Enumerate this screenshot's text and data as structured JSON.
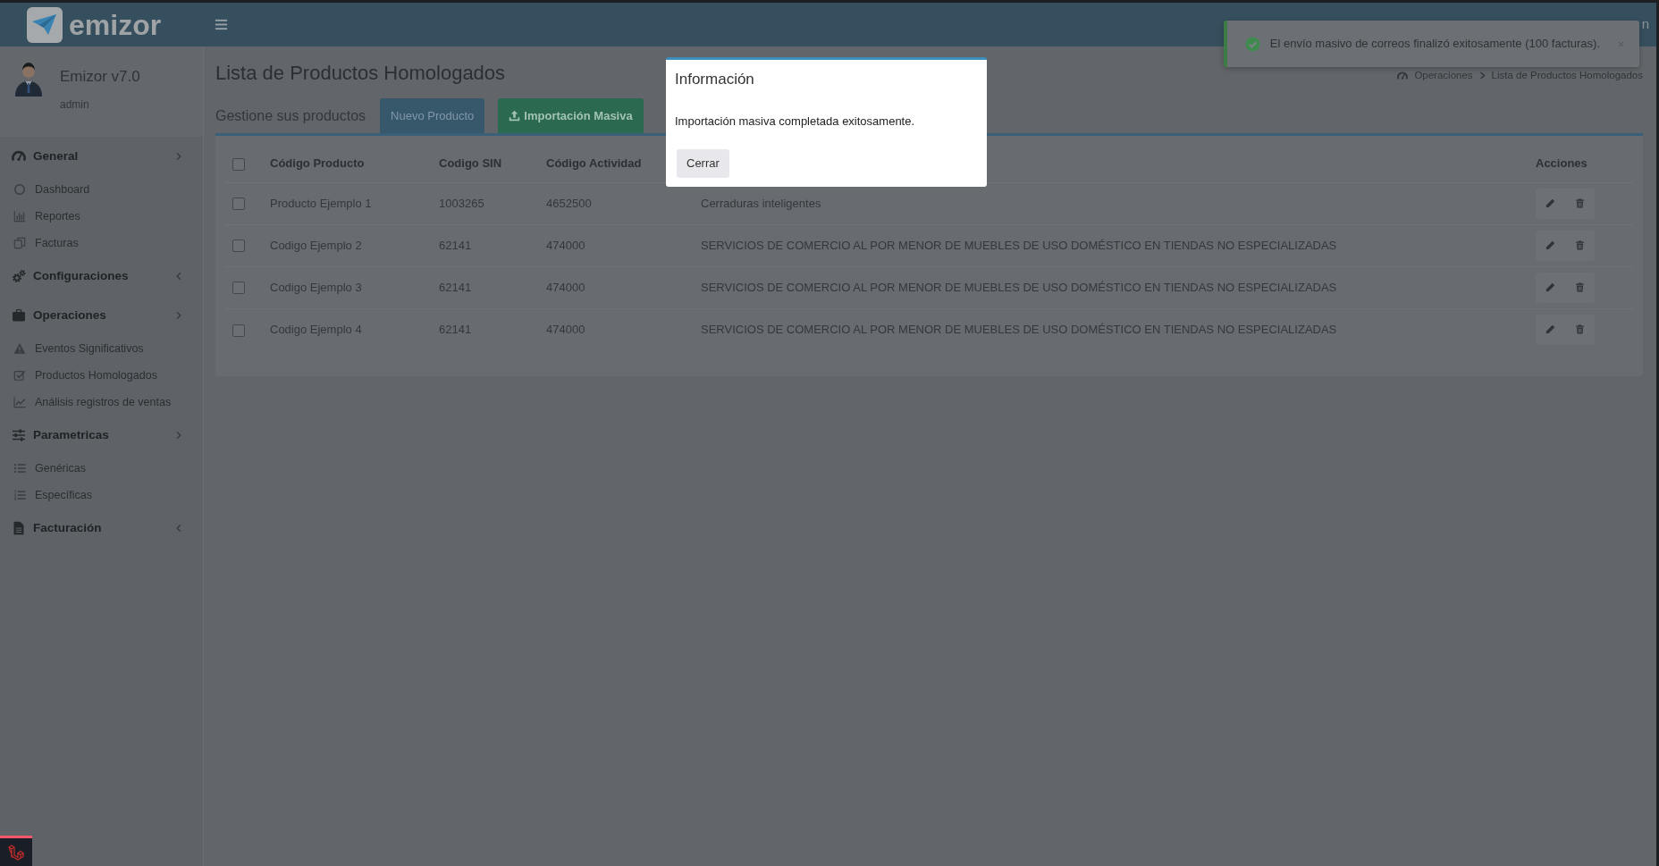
{
  "header": {
    "logo_text": "emizor",
    "user_text": "n"
  },
  "sidebar": {
    "user": {
      "name": "Emizor v7.0",
      "role": "admin"
    },
    "groups": [
      {
        "label": "General",
        "expanded": true,
        "children": [
          {
            "label": "Dashboard"
          },
          {
            "label": "Reportes"
          },
          {
            "label": "Facturas"
          }
        ]
      },
      {
        "label": "Configuraciones",
        "expanded": false
      },
      {
        "label": "Operaciones",
        "expanded": true,
        "children": [
          {
            "label": "Eventos Significativos"
          },
          {
            "label": "Productos Homologados"
          },
          {
            "label": "Análisis registros de ventas"
          }
        ]
      },
      {
        "label": "Parametricas",
        "expanded": true,
        "children": [
          {
            "label": "Genéricas"
          },
          {
            "label": "Específicas"
          }
        ]
      },
      {
        "label": "Facturación",
        "expanded": false
      }
    ]
  },
  "page": {
    "title": "Lista de Productos Homologados",
    "breadcrumb": [
      "Operaciones",
      "Lista de Productos Homologados"
    ]
  },
  "toolbar": {
    "heading": "Gestione sus productos",
    "buttons": [
      {
        "label": "Nuevo Producto",
        "kind": "primary"
      },
      {
        "label": "Importación Masiva",
        "kind": "success"
      }
    ]
  },
  "table": {
    "select_all_checked": false,
    "columns": [
      "Código Producto",
      "Codigo SIN",
      "Código Actividad",
      "Acciones"
    ],
    "rows": [
      {
        "checked": false,
        "cells": [
          "Producto Ejemplo 1",
          "1003265",
          "4652500",
          "Cerraduras inteligentes"
        ]
      },
      {
        "checked": false,
        "cells": [
          "Codigo Ejemplo 2",
          "62141",
          "474000",
          "SERVICIOS DE COMERCIO AL POR MENOR DE MUEBLES DE USO DOMÉSTICO EN TIENDAS NO ESPECIALIZADAS"
        ]
      },
      {
        "checked": false,
        "cells": [
          "Codigo Ejemplo 3",
          "62141",
          "474000",
          "SERVICIOS DE COMERCIO AL POR MENOR DE MUEBLES DE USO DOMÉSTICO EN TIENDAS NO ESPECIALIZADAS"
        ]
      },
      {
        "checked": false,
        "cells": [
          "Codigo Ejemplo 4",
          "62141",
          "474000",
          "SERVICIOS DE COMERCIO AL POR MENOR DE MUEBLES DE USO DOMÉSTICO EN TIENDAS NO ESPECIALIZADAS"
        ]
      }
    ]
  },
  "modal": {
    "title": "Información",
    "message": "Importación masiva completada exitosamente.",
    "button": "Cerrar"
  },
  "toast": {
    "kind": "success",
    "message": "El envío masivo de correos finalizó exitosamente (100 facturas)."
  }
}
